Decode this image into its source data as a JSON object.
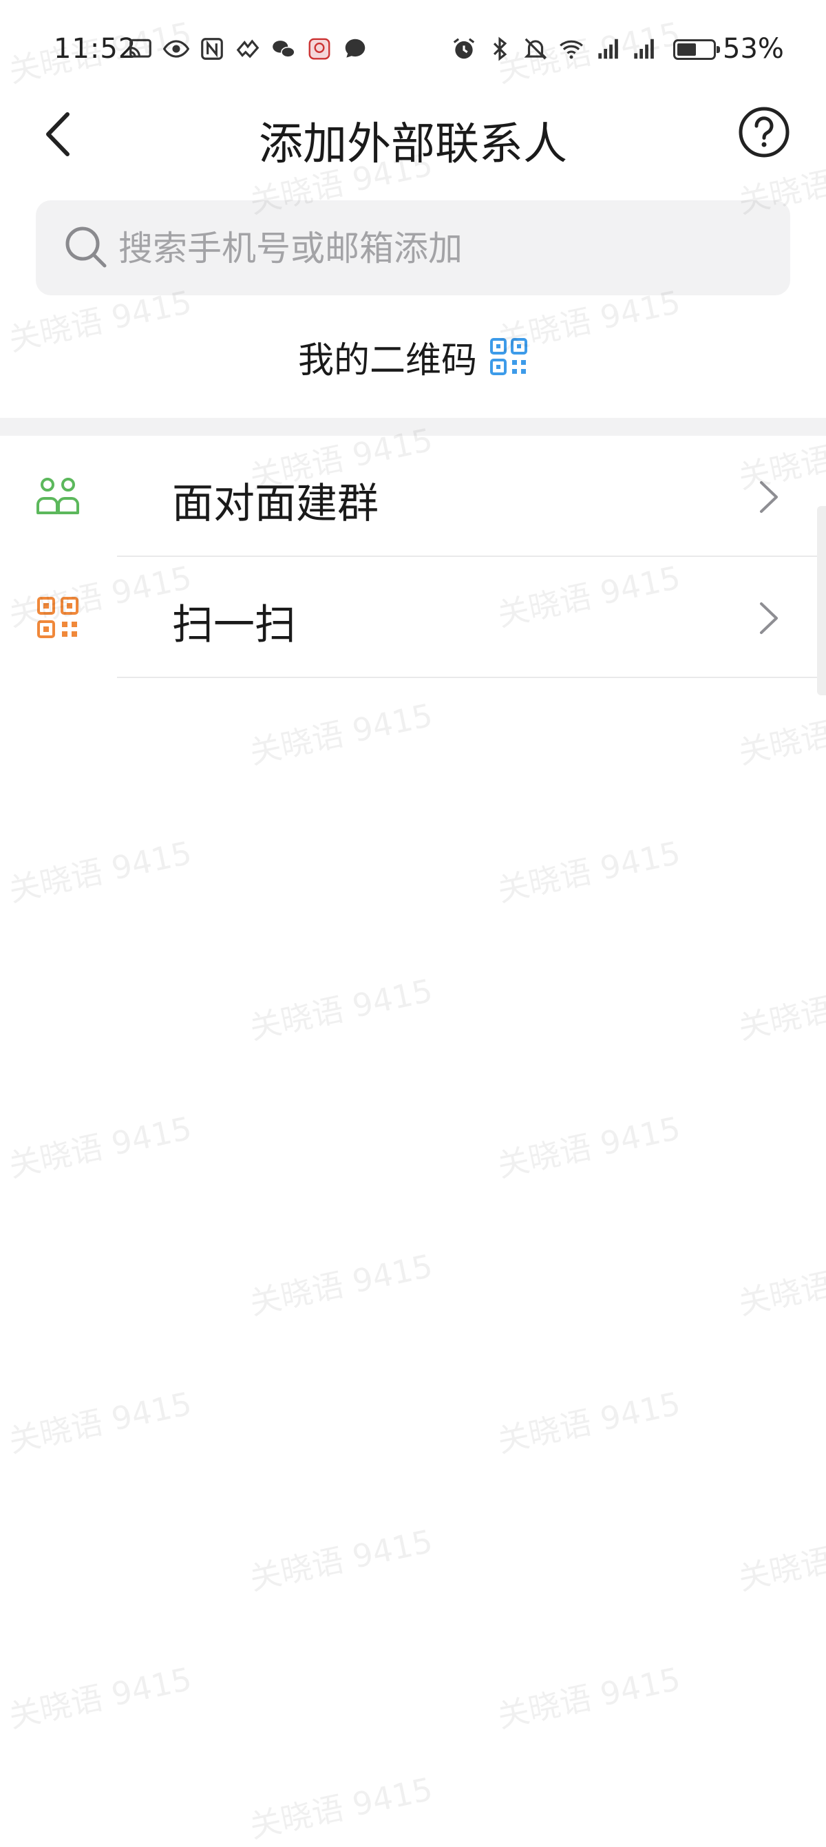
{
  "status_bar": {
    "time": "11:52",
    "battery": "53%"
  },
  "header": {
    "title": "添加外部联系人"
  },
  "search": {
    "placeholder": "搜索手机号或邮箱添加",
    "value": ""
  },
  "my_qr": {
    "label": "我的二维码"
  },
  "menu": {
    "items": [
      {
        "label": "面对面建群",
        "icon": "people-group-icon",
        "icon_color": "#5cb85c"
      },
      {
        "label": "扫一扫",
        "icon": "scan-qr-icon",
        "icon_color": "#f0883a"
      }
    ]
  },
  "watermark": {
    "text": "关晓语 9415"
  },
  "colors": {
    "qr_icon": "#3d9be9",
    "group_icon": "#5cb85c",
    "scan_icon": "#f0883a"
  }
}
